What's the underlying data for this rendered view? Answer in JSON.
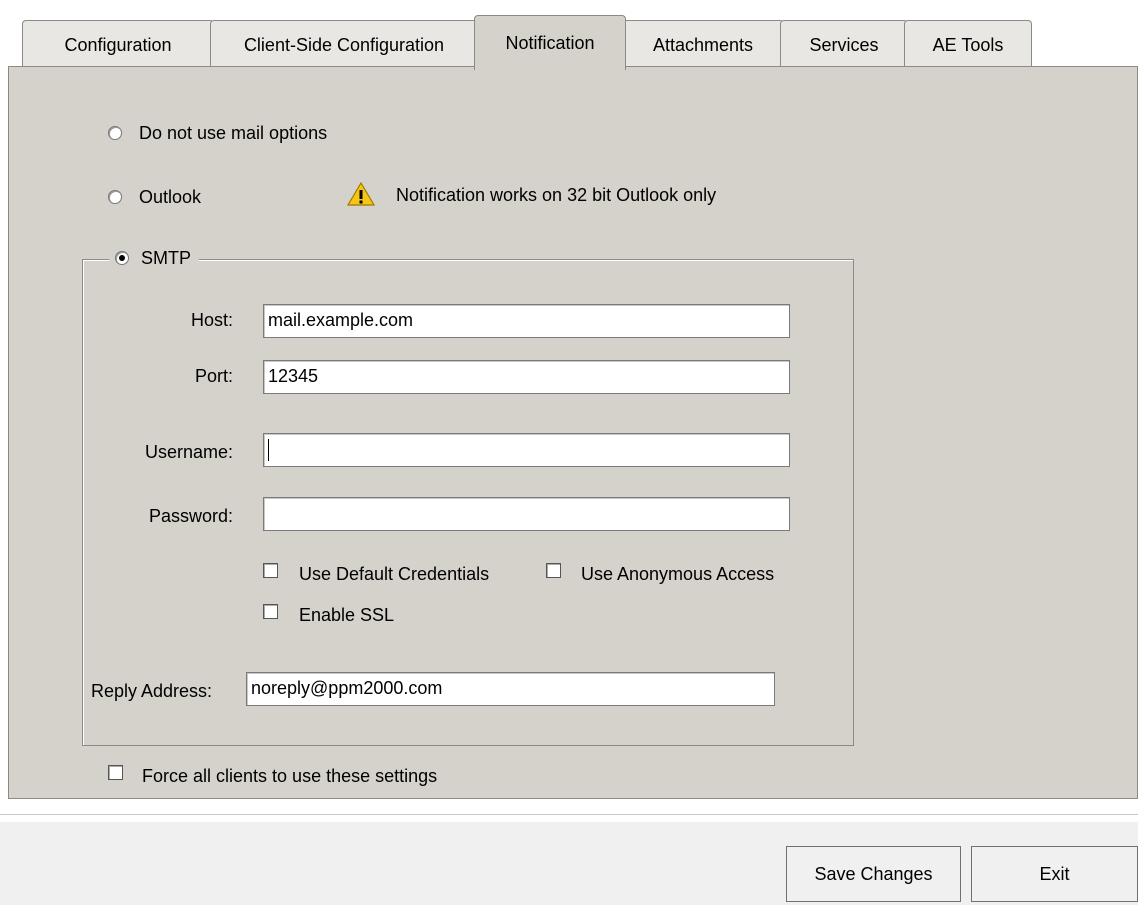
{
  "tabs": [
    {
      "label": "Configuration"
    },
    {
      "label": "Client-Side Configuration"
    },
    {
      "label": "Notification",
      "active": true
    },
    {
      "label": "Attachments"
    },
    {
      "label": "Services"
    },
    {
      "label": "AE Tools"
    }
  ],
  "mail_options": {
    "none_label": "Do not use mail options",
    "outlook_label": "Outlook",
    "outlook_warning": "Notification works on 32 bit Outlook only",
    "smtp_label": "SMTP",
    "selected": "SMTP"
  },
  "smtp": {
    "host_label": "Host:",
    "host_value": "mail.example.com",
    "port_label": "Port:",
    "port_value": "12345",
    "username_label": "Username:",
    "username_value": "",
    "password_label": "Password:",
    "password_value": "",
    "use_default_credentials_label": "Use Default Credentials",
    "use_default_credentials_checked": false,
    "use_anonymous_access_label": "Use Anonymous Access",
    "use_anonymous_access_checked": false,
    "enable_ssl_label": "Enable SSL",
    "enable_ssl_checked": false,
    "reply_address_label": "Reply Address:",
    "reply_address_value": "noreply@ppm2000.com"
  },
  "force_all_clients_label": "Force all clients to use these settings",
  "force_all_clients_checked": false,
  "footer": {
    "save_label": "Save Changes",
    "exit_label": "Exit"
  },
  "colors": {
    "panel_bg": "#d5d1cb",
    "warning_yellow": "#f5c518"
  }
}
